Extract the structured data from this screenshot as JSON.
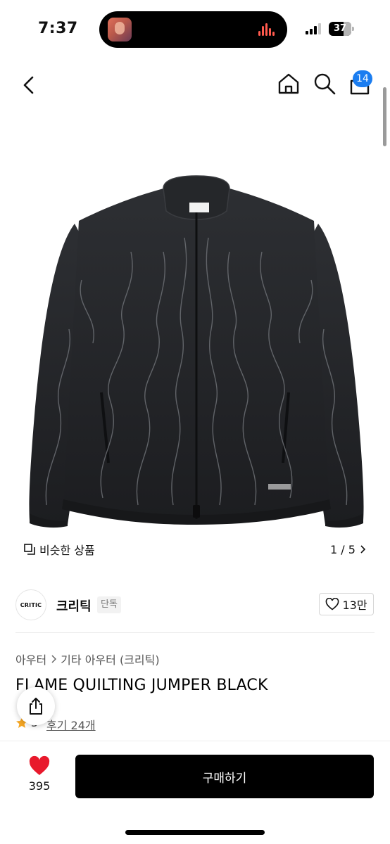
{
  "status_bar": {
    "time": "7:37",
    "battery": "37"
  },
  "header": {
    "cart_count": "14"
  },
  "gallery": {
    "similar_label": "비슷한 상품",
    "pager": "1 / 5"
  },
  "brand": {
    "logo_text": "CRITIC",
    "name": "크리틱",
    "tag": "단독",
    "likes": "13만"
  },
  "product": {
    "breadcrumb": [
      "아우터",
      "기타 아우터 (크리틱)"
    ],
    "title": "FLAME QUILTING JUMPER BLACK",
    "rating": "5",
    "review_link": "후기 24개"
  },
  "bottom": {
    "like_count": "395",
    "buy_label": "구매하기"
  },
  "colors": {
    "accent_badge": "#1b7df0",
    "heart": "#e8192c",
    "star": "#f5a623",
    "buy_button": "#000000"
  }
}
